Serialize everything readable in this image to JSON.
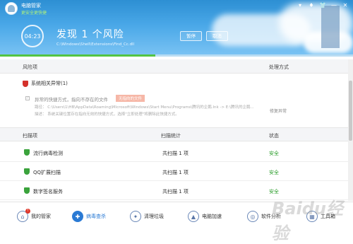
{
  "app": {
    "title": "电脑管家",
    "subtitle": "更安全更快捷"
  },
  "window_controls": [
    "▾",
    "♦",
    "👕",
    "—",
    "✕"
  ],
  "header": {
    "timer": "04:23",
    "headline": "发现 1 个风险",
    "scan_path": "C:\\Windows\\Shell\\Extensions\\Find_Cc.dll",
    "pause_label": "暂停",
    "cancel_label": "取消",
    "progress": 0.44
  },
  "risk_table": {
    "col_item": "风险项",
    "col_action": "处理方式",
    "group": {
      "label": "系统相关异常(1)",
      "icon": "red-shield"
    },
    "items": [
      {
        "title": "异常的快捷方式，指向不存在的文件",
        "tag": "无指向的文件",
        "path": "路径： C:\\Users\\1\\HB\\AppData\\Roaming\\Microsoft\\Windows\\Start Menu\\Programs\\腾讯的企鹅.lnk -> E:\\腾讯的企鹅...",
        "desc": "描述： 系统关键位置存在指向无效的快捷方式，选择\"立即处理\"将删除此快捷方式。",
        "action": "修复异常"
      }
    ]
  },
  "scan_table": {
    "col_item": "扫描项",
    "col_stats": "扫描统计",
    "col_status": "状态",
    "rows": [
      {
        "name": "流行病毒检测",
        "count": "共扫描 1 项",
        "status": "安全"
      },
      {
        "name": "QQ扩展扫描",
        "count": "共扫描 1 项",
        "status": "安全"
      },
      {
        "name": "数字签名服务",
        "count": "共扫描 1 项",
        "status": "安全"
      }
    ]
  },
  "bottom_nav": [
    {
      "label": "我的管家",
      "icon": "home-icon",
      "glyph": "⌂",
      "badge": "!"
    },
    {
      "label": "病毒查杀",
      "icon": "virus-scan-icon",
      "glyph": "✚",
      "active": true
    },
    {
      "label": "清理垃圾",
      "icon": "broom-icon",
      "glyph": "✦"
    },
    {
      "label": "电脑加速",
      "icon": "rocket-icon",
      "glyph": "▲"
    },
    {
      "label": "软件分析",
      "icon": "software-icon",
      "glyph": "◎"
    },
    {
      "label": "工具箱",
      "icon": "toolbox-icon",
      "glyph": "▦"
    }
  ],
  "watermark": "Baidu经验"
}
